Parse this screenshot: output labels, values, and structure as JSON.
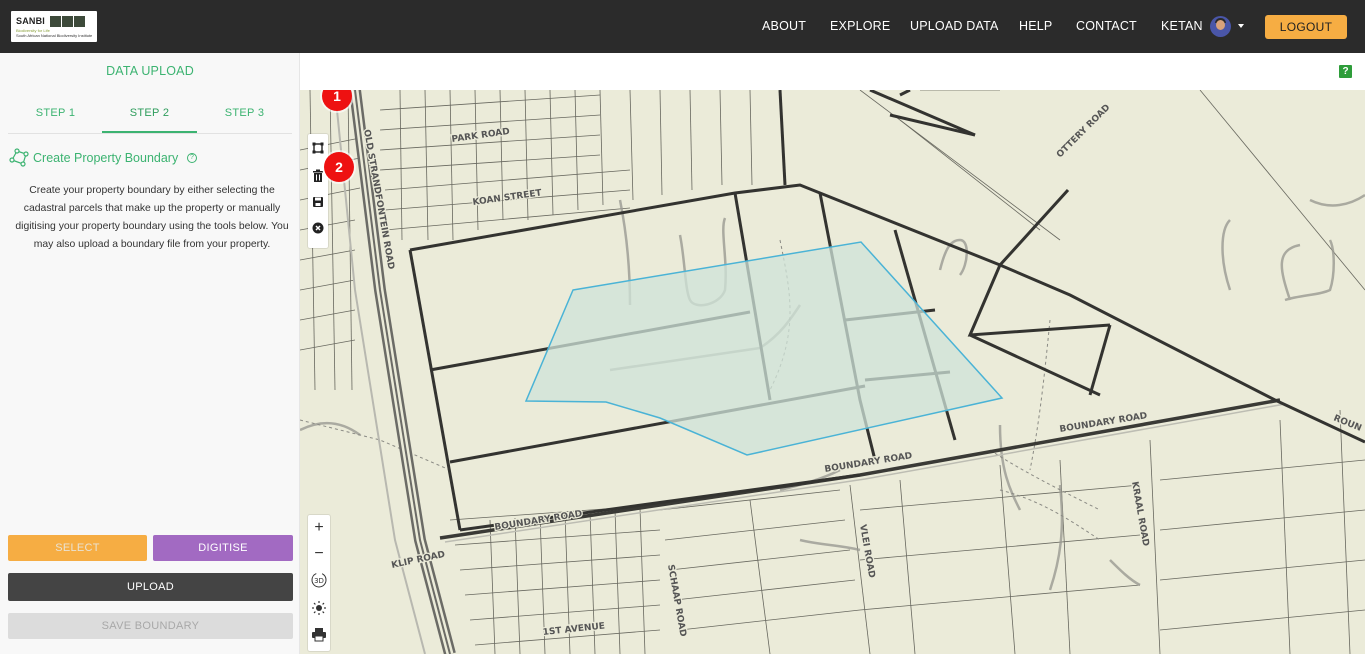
{
  "header": {
    "logo": {
      "title": "SANBI",
      "subtitle": "Biodiversity for Life",
      "caption": "South African National Biodiversity Institute"
    },
    "nav": [
      "ABOUT",
      "EXPLORE",
      "UPLOAD DATA",
      "HELP",
      "CONTACT"
    ],
    "user": "KETAN",
    "logout": "LOGOUT"
  },
  "sidebar": {
    "title": "DATA UPLOAD",
    "tabs": [
      {
        "label": "STEP 1",
        "active": false
      },
      {
        "label": "STEP 2",
        "active": true
      },
      {
        "label": "STEP 3",
        "active": false
      }
    ],
    "section_title": "Create Property Boundary",
    "help_glyph": "?",
    "description": "Create your property boundary by either selecting the cadastral parcels that make up the property or manually digitising your property boundary using the tools below. You may also upload a boundary file from your property.",
    "buttons": {
      "select": "SELECT",
      "digitise": "DIGITISE",
      "upload": "UPLOAD",
      "save": "SAVE BOUNDARY"
    }
  },
  "map": {
    "help_button": "?",
    "markers": [
      "1",
      "2"
    ],
    "tools": [
      "polygon-draw-icon",
      "trash-icon",
      "save-icon",
      "close-circle-icon"
    ],
    "zoom": {
      "in": "+",
      "out": "−",
      "mode_3d": "3D"
    },
    "road_labels": [
      "PARK ROAD",
      "KOAN STREET",
      "OLD STRANDFONTEIN ROAD",
      "OTTERY ROAD",
      "BOUNDARY ROAD",
      "BOUNDARY ROAD",
      "BOUNDARY ROAD",
      "KLIP ROAD",
      "SCHAAP ROAD",
      "VLEI ROAD",
      "KRAAL ROAD",
      "1ST AVENUE",
      "ROUN"
    ]
  },
  "colors": {
    "accent_green": "#3cb371",
    "orange": "#f6ad43",
    "purple": "#a26ac2",
    "dark": "#2b2b2b",
    "map_bg": "#ebebd9",
    "boundary_stroke": "#4ab3d6",
    "boundary_fill": "#cfe3d8"
  }
}
